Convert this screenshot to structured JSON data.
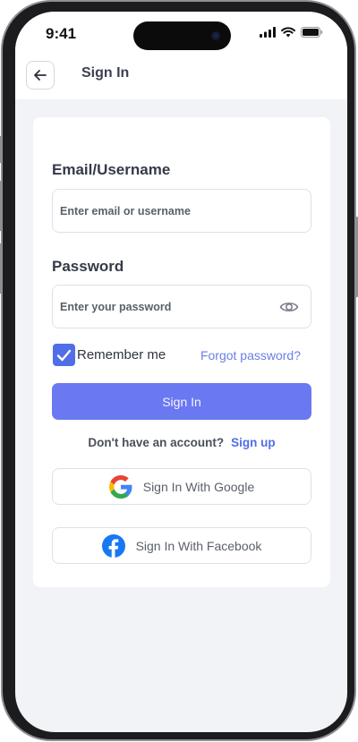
{
  "status_bar": {
    "time": "9:41"
  },
  "header": {
    "title": "Sign In",
    "back_icon": "arrow-left-icon"
  },
  "form": {
    "email": {
      "label": "Email/Username",
      "placeholder": "Enter email or username",
      "value": ""
    },
    "password": {
      "label": "Password",
      "placeholder": "Enter your password",
      "value": "",
      "toggle_icon": "eye-icon"
    },
    "remember": {
      "label": "Remember me",
      "checked": true
    },
    "forgot_label": "Forgot password?",
    "submit_label": "Sign In",
    "signup_prompt": "Don't have an account?",
    "signup_label": "Sign up",
    "google_label": "Sign In With Google",
    "facebook_label": "Sign In With Facebook"
  },
  "colors": {
    "accent": "#6a78f2",
    "checkbox": "#4f6ee8",
    "link": "#6b7ee6",
    "background": "#f2f3f7",
    "facebook": "#1877f2"
  }
}
